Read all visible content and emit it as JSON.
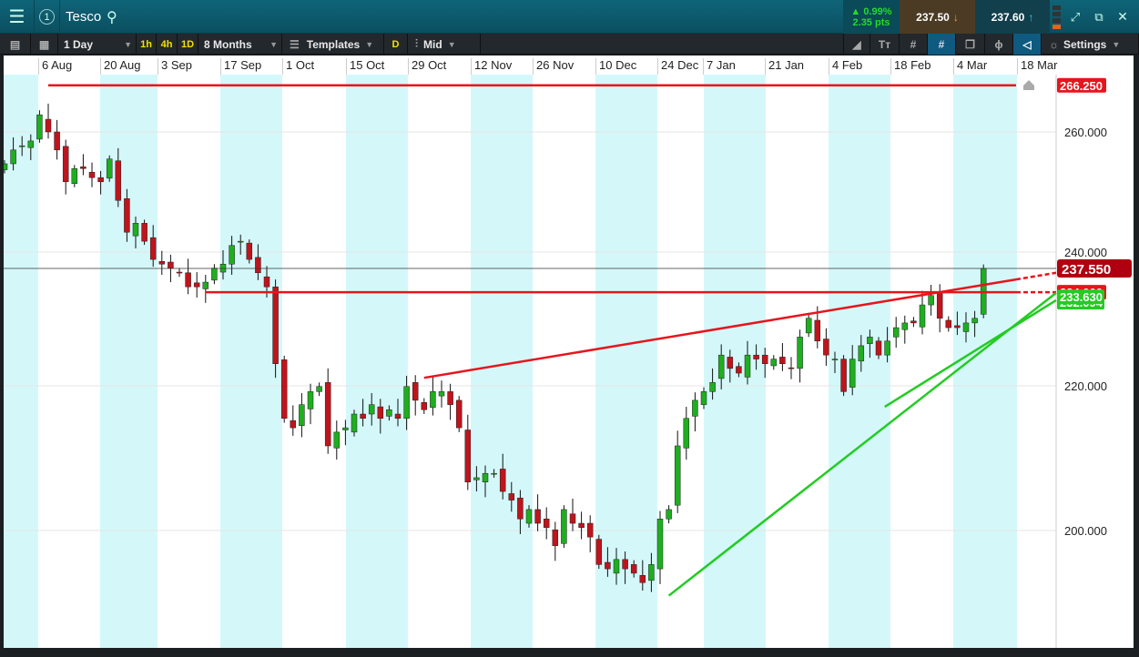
{
  "header": {
    "instrument": "Tesco",
    "window_number": "1",
    "change_pct": "▲ 0.99%",
    "change_pts": "2.35 pts",
    "sell_price": "237.50",
    "buy_price": "237.60"
  },
  "toolbar": {
    "interval": "1 Day",
    "quick_intervals": [
      "1h",
      "4h",
      "1D"
    ],
    "range": "8 Months",
    "templates": "Templates",
    "d_badge": "D",
    "price_type": "Mid",
    "settings": "Settings"
  },
  "date_axis": [
    "6 Aug",
    "20 Aug",
    "3 Sep",
    "17 Sep",
    "1 Oct",
    "15 Oct",
    "29 Oct",
    "12 Nov",
    "26 Nov",
    "10 Dec",
    "24 Dec",
    "7 Jan",
    "21 Jan",
    "4 Feb",
    "18 Feb",
    "4 Mar",
    "18 Mar"
  ],
  "price_axis": [
    "260.000",
    "240.000",
    "220.000",
    "200.000"
  ],
  "price_labels": {
    "resistance": "266.250",
    "current": "237.550",
    "hidden": "234.000",
    "green1": "233.630",
    "green2": "232.094"
  },
  "colors": {
    "up": "#1fae1f",
    "down": "#c0141c",
    "red_line": "#e8141c",
    "green_line": "#22cc22",
    "band": "#d4f8fa"
  },
  "chart_data": {
    "type": "candlestick",
    "title": "Tesco",
    "closes": [
      254.7,
      257.0,
      257.7,
      258.5,
      262.3,
      260.0,
      257.0,
      251.7,
      253.9,
      253.9,
      252.4,
      251.7,
      255.5,
      248.6,
      243.3,
      244.8,
      241.8,
      238.9,
      238.2,
      237.6,
      236.9,
      234.8,
      234.8,
      235.5,
      237.6,
      238.2,
      241.1,
      241.8,
      238.9,
      236.9,
      234.8,
      223.3,
      215.5,
      214.2,
      217.4,
      219.2,
      219.9,
      211.7,
      213.6,
      214.2,
      216.1,
      215.5,
      217.4,
      215.5,
      216.7,
      215.5,
      219.9,
      218.0,
      216.7,
      219.2,
      219.2,
      217.4,
      214.2,
      206.7,
      207.3,
      207.9,
      207.9,
      205.4,
      204.2,
      201.6,
      202.9,
      201.0,
      200.4,
      197.9,
      202.9,
      201.0,
      200.4,
      199.1,
      195.3,
      194.7,
      196.0,
      194.7,
      194.1,
      192.8,
      195.3,
      201.6,
      202.9,
      211.7,
      215.5,
      218.0,
      219.2,
      220.5,
      224.6,
      222.6,
      221.9,
      224.6,
      224.0,
      223.3,
      224.0,
      223.3,
      222.6,
      227.3,
      230.1,
      226.7,
      224.6,
      224.0,
      219.2,
      224.0,
      226.0,
      227.3,
      224.6,
      226.7,
      228.7,
      229.4,
      229.4,
      232.1,
      233.5,
      230.1,
      228.7,
      228.7,
      229.4,
      230.1,
      237.55
    ],
    "horizontal_lines": [
      {
        "price": 266.25,
        "from_index": 5,
        "color": "red"
      },
      {
        "price": 234.0,
        "from_index": 23,
        "color": "red"
      },
      {
        "price": 237.55,
        "from_index": 0,
        "color": "black"
      }
    ],
    "trend_lines": [
      {
        "from": [
          48,
          221.2
        ],
        "to": [
          120,
          236.9
        ],
        "color": "red"
      },
      {
        "from": [
          76,
          191.0
        ],
        "to": [
          120,
          233.9
        ],
        "color": "green"
      },
      {
        "from": [
          100.7,
          217.1
        ],
        "to": [
          120,
          232.8
        ],
        "color": "green"
      }
    ],
    "ylim": [
      188,
      270
    ]
  }
}
